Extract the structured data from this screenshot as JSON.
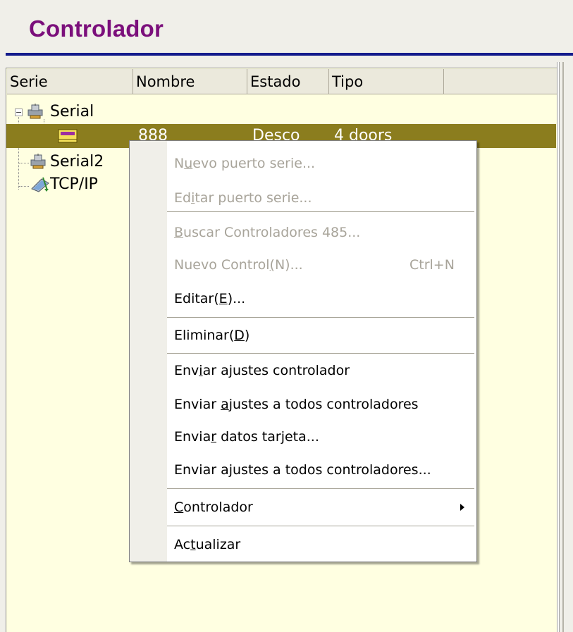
{
  "window": {
    "title": "Controlador"
  },
  "columns": [
    "Serie",
    "Nombre",
    "Estado",
    "Tipo"
  ],
  "tree": [
    {
      "label": "Serial",
      "icon": "serial-port-icon",
      "expanded": true
    },
    {
      "label": "",
      "icon": "controller-icon",
      "nombre": "888",
      "estado": "Desco",
      "tipo": "4 doors",
      "selected": true
    },
    {
      "label": "Serial2",
      "icon": "serial-port-icon"
    },
    {
      "label": "TCP/IP",
      "icon": "network-icon"
    }
  ],
  "menu": [
    {
      "label": "Nuevo puerto serie...",
      "underline": 1,
      "enabled": false
    },
    {
      "label": "Editar puerto serie...",
      "underline": 2,
      "enabled": false
    },
    {
      "label": "Buscar Controladores 485...",
      "underline": 0,
      "enabled": false
    },
    {
      "label": "Nuevo Control(N)...",
      "underline": 13,
      "shortcut": "Ctrl+N",
      "enabled": false
    },
    {
      "label": "Editar(E)...",
      "underline": 7,
      "enabled": true
    },
    {
      "label": "Eliminar(D)",
      "underline": 9,
      "enabled": true
    },
    {
      "label": "Enviar ajustes controlador",
      "underline": 3,
      "enabled": true
    },
    {
      "label": "Enviar ajustes a todos controladores",
      "underline": 7,
      "enabled": true
    },
    {
      "label": "Enviar datos tarjeta...",
      "underline": 5,
      "enabled": true
    },
    {
      "label": "Enviar ajustes a todos controladores...",
      "underline": 8,
      "enabled": true
    },
    {
      "label": "Controlador",
      "underline": 0,
      "enabled": true,
      "submenu": true
    },
    {
      "label": "Actualizar",
      "underline": 2,
      "enabled": true
    }
  ]
}
